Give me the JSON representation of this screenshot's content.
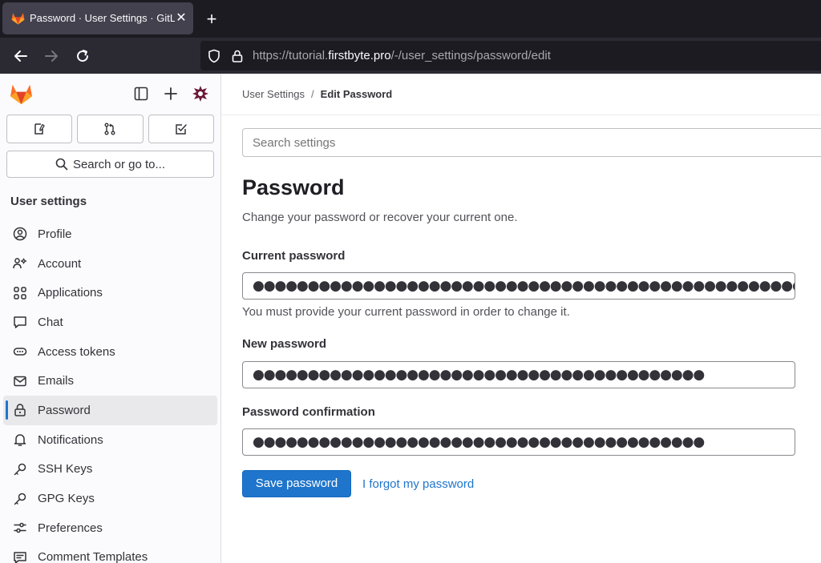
{
  "browser": {
    "tab_title": "Password · User Settings · GitLab",
    "tab_close": "✕",
    "new_tab": "+",
    "url_prefix": "https://tutorial.",
    "url_host": "firstbyte.pro",
    "url_path": "/-/user_settings/password/edit"
  },
  "sidebar": {
    "search_label": "Search or go to...",
    "heading": "User settings",
    "items": [
      {
        "label": "Profile",
        "icon": "profile-icon"
      },
      {
        "label": "Account",
        "icon": "account-icon"
      },
      {
        "label": "Applications",
        "icon": "applications-icon"
      },
      {
        "label": "Chat",
        "icon": "chat-icon"
      },
      {
        "label": "Access tokens",
        "icon": "token-icon"
      },
      {
        "label": "Emails",
        "icon": "mail-icon"
      },
      {
        "label": "Password",
        "icon": "lock-icon",
        "active": true
      },
      {
        "label": "Notifications",
        "icon": "bell-icon"
      },
      {
        "label": "SSH Keys",
        "icon": "key-icon"
      },
      {
        "label": "GPG Keys",
        "icon": "key-icon"
      },
      {
        "label": "Preferences",
        "icon": "preferences-icon"
      },
      {
        "label": "Comment Templates",
        "icon": "comment-template-icon"
      }
    ]
  },
  "breadcrumb": {
    "parent": "User Settings",
    "separator": "/",
    "current": "Edit Password"
  },
  "main": {
    "search_placeholder": "Search settings",
    "title": "Password",
    "subtitle": "Change your password or recover your current one.",
    "current_password_label": "Current password",
    "current_password_value": "●●●●●●●●●●●●●●●●●●●●●●●●●●●●●●●●●●●●●●●●●●●●●●●●●●●",
    "current_password_help": "You must provide your current password in order to change it.",
    "new_password_label": "New password",
    "new_password_value": "●●●●●●●●●●●●●●●●●●●●●●●●●●●●●●●●●●●●●●●●●",
    "confirm_label": "Password confirmation",
    "confirm_value": "●●●●●●●●●●●●●●●●●●●●●●●●●●●●●●●●●●●●●●●●●",
    "save_label": "Save password",
    "forgot_label": "I forgot my password"
  },
  "colors": {
    "accent": "#1f75cb",
    "tabbar": "#1c1b22",
    "gitlab_orange": "#fc6d26"
  }
}
